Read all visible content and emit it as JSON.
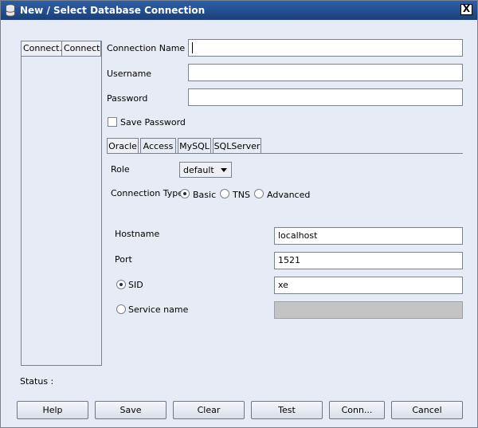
{
  "window": {
    "title": "New / Select Database Connection",
    "close_label": "X"
  },
  "connections_table": {
    "columns": [
      "Connect...",
      "Connect..."
    ]
  },
  "form": {
    "connection_name_label": "Connection Name",
    "connection_name_value": "",
    "username_label": "Username",
    "username_value": "",
    "password_label": "Password",
    "password_value": "",
    "save_password_label": "Save Password",
    "save_password_checked": false
  },
  "tabs": [
    {
      "label": "Oracle",
      "active": true
    },
    {
      "label": "Access",
      "active": false
    },
    {
      "label": "MySQL",
      "active": false
    },
    {
      "label": "SQLServer",
      "active": false
    }
  ],
  "oracle": {
    "role_label": "Role",
    "role_value": "default",
    "connection_type_label": "Connection Type",
    "connection_types": [
      "Basic",
      "TNS",
      "Advanced"
    ],
    "connection_type_selected": "Basic",
    "hostname_label": "Hostname",
    "hostname_value": "localhost",
    "port_label": "Port",
    "port_value": "1521",
    "sid_label": "SID",
    "sid_value": "xe",
    "service_name_label": "Service name",
    "service_name_value": ""
  },
  "status": {
    "label": "Status :"
  },
  "buttons": {
    "help": "Help",
    "save": "Save",
    "clear": "Clear",
    "test": "Test",
    "connect": "Conn...",
    "cancel": "Cancel"
  }
}
